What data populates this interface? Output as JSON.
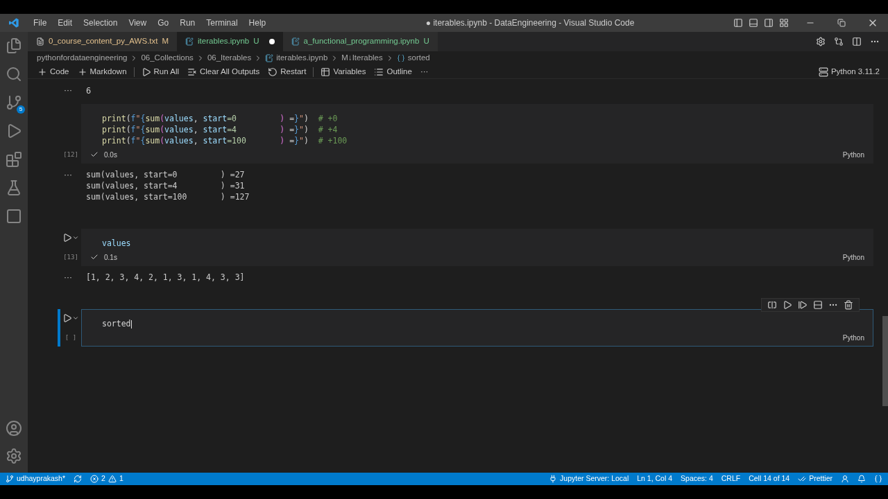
{
  "menu": [
    "File",
    "Edit",
    "Selection",
    "View",
    "Go",
    "Run",
    "Terminal",
    "Help"
  ],
  "window": {
    "title": "● iterables.ipynb - DataEngineering - Visual Studio Code"
  },
  "activity_bar": {
    "badge": "5"
  },
  "tabs": [
    {
      "label": "0_course_content_py_AWS.txt",
      "status": "M",
      "selected": false,
      "kind": "text",
      "dirty": false
    },
    {
      "label": "iterables.ipynb",
      "status": "U",
      "selected": true,
      "kind": "notebook",
      "dirty": true
    },
    {
      "label": "a_functional_programming.ipynb",
      "status": "U",
      "selected": false,
      "kind": "notebook",
      "dirty": false
    }
  ],
  "breadcrumb": [
    {
      "label": "pythonfordataengineering",
      "kind": "folder"
    },
    {
      "label": "06_Collections",
      "kind": "folder"
    },
    {
      "label": "06_Iterables",
      "kind": "folder"
    },
    {
      "label": "iterables.ipynb",
      "kind": "notebook"
    },
    {
      "label": "M↓Iterables",
      "kind": "folder"
    },
    {
      "label": "sorted",
      "kind": "python"
    }
  ],
  "toolbar": [
    {
      "label": "Code",
      "kind": "plus"
    },
    {
      "label": "Markdown",
      "kind": "plus"
    },
    {
      "label": "Run All",
      "kind": "run"
    },
    {
      "label": "Clear All Outputs",
      "kind": "clear"
    },
    {
      "label": "Restart",
      "kind": "restart"
    },
    {
      "label": "Variables",
      "kind": "variables"
    },
    {
      "label": "Outline",
      "kind": "outline"
    },
    {
      "label": "···",
      "kind": "more"
    }
  ],
  "kernel": "Python 3.11.2",
  "cells": [
    {
      "kind": "output_only",
      "output_menu": "···",
      "output": [
        "6"
      ]
    },
    {
      "kind": "code",
      "selected": false,
      "show_run": false,
      "count": "[12]",
      "time": "0.0s",
      "language": "Python",
      "code": [
        [
          {
            "text": "print",
            "kind": "fn"
          },
          {
            "text": "(",
            "kind": "p"
          },
          {
            "text": "f",
            "kind": "kw"
          },
          {
            "text": "\"",
            "kind": "str"
          },
          {
            "text": "{",
            "kind": "kw"
          },
          {
            "text": "sum",
            "kind": "fn"
          },
          {
            "text": "(",
            "kind": "br"
          },
          {
            "text": "values",
            "kind": "var"
          },
          {
            "text": ", ",
            "kind": "p"
          },
          {
            "text": "start",
            "kind": "var"
          },
          {
            "text": "=0         ",
            "kind": "num"
          },
          {
            "text": ")",
            "kind": "br"
          },
          {
            "text": " =",
            "kind": "p"
          },
          {
            "text": "}",
            "kind": "kw"
          },
          {
            "text": "\"",
            "kind": "str"
          },
          {
            "text": ")",
            "kind": "p"
          },
          {
            "text": "  # +0",
            "kind": "cm"
          }
        ],
        [
          {
            "text": "print",
            "kind": "fn"
          },
          {
            "text": "(",
            "kind": "p"
          },
          {
            "text": "f",
            "kind": "kw"
          },
          {
            "text": "\"",
            "kind": "str"
          },
          {
            "text": "{",
            "kind": "kw"
          },
          {
            "text": "sum",
            "kind": "fn"
          },
          {
            "text": "(",
            "kind": "br"
          },
          {
            "text": "values",
            "kind": "var"
          },
          {
            "text": ", ",
            "kind": "p"
          },
          {
            "text": "start",
            "kind": "var"
          },
          {
            "text": "=4         ",
            "kind": "num"
          },
          {
            "text": ")",
            "kind": "br"
          },
          {
            "text": " =",
            "kind": "p"
          },
          {
            "text": "}",
            "kind": "kw"
          },
          {
            "text": "\"",
            "kind": "str"
          },
          {
            "text": ")",
            "kind": "p"
          },
          {
            "text": "  # +4",
            "kind": "cm"
          }
        ],
        [
          {
            "text": "print",
            "kind": "fn"
          },
          {
            "text": "(",
            "kind": "p"
          },
          {
            "text": "f",
            "kind": "kw"
          },
          {
            "text": "\"",
            "kind": "str"
          },
          {
            "text": "{",
            "kind": "kw"
          },
          {
            "text": "sum",
            "kind": "fn"
          },
          {
            "text": "(",
            "kind": "br"
          },
          {
            "text": "values",
            "kind": "var"
          },
          {
            "text": ", ",
            "kind": "p"
          },
          {
            "text": "start",
            "kind": "var"
          },
          {
            "text": "=100       ",
            "kind": "num"
          },
          {
            "text": ")",
            "kind": "br"
          },
          {
            "text": " =",
            "kind": "p"
          },
          {
            "text": "}",
            "kind": "kw"
          },
          {
            "text": "\"",
            "kind": "str"
          },
          {
            "text": ")",
            "kind": "p"
          },
          {
            "text": "  # +100",
            "kind": "cm"
          }
        ]
      ],
      "output_menu": "···",
      "output": [
        "sum(values, start=0         ) =27",
        "sum(values, start=4         ) =31",
        "sum(values, start=100       ) =127"
      ]
    },
    {
      "kind": "code",
      "selected": false,
      "show_run": true,
      "count": "[13]",
      "time": "0.1s",
      "language": "Python",
      "code": [
        [
          {
            "text": "values",
            "kind": "var"
          }
        ]
      ],
      "output_menu": "···",
      "output": [
        "[1, 2, 3, 4, 2, 1, 3, 1, 4, 3, 3]"
      ]
    },
    {
      "kind": "code",
      "selected": true,
      "show_run": true,
      "count": "[ ]",
      "language": "Python",
      "code": [
        [
          {
            "text": "sorted",
            "kind": "p"
          }
        ]
      ]
    }
  ],
  "status_bar": {
    "branch": "udhayprakash*",
    "errors": "2",
    "warnings": "1",
    "right": [
      "Jupyter Server: Local",
      "Ln 1, Col 4",
      "Spaces: 4",
      "CRLF",
      "Cell 14 of 14",
      "Prettier"
    ]
  }
}
